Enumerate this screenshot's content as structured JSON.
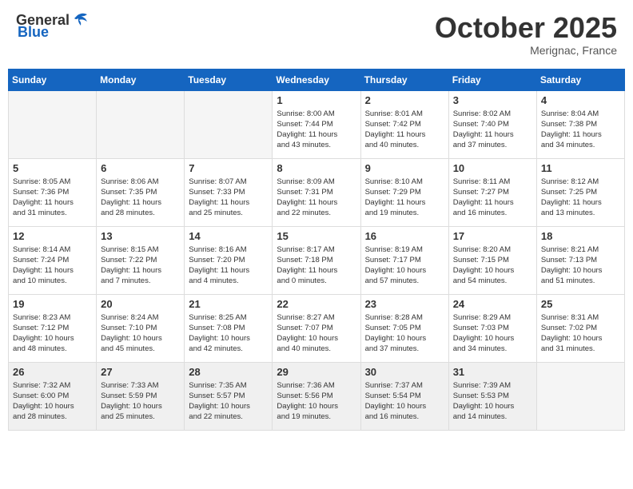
{
  "header": {
    "logo_general": "General",
    "logo_blue": "Blue",
    "month_year": "October 2025",
    "location": "Merignac, France"
  },
  "weekdays": [
    "Sunday",
    "Monday",
    "Tuesday",
    "Wednesday",
    "Thursday",
    "Friday",
    "Saturday"
  ],
  "weeks": [
    [
      {
        "day": "",
        "info": ""
      },
      {
        "day": "",
        "info": ""
      },
      {
        "day": "",
        "info": ""
      },
      {
        "day": "1",
        "info": "Sunrise: 8:00 AM\nSunset: 7:44 PM\nDaylight: 11 hours\nand 43 minutes."
      },
      {
        "day": "2",
        "info": "Sunrise: 8:01 AM\nSunset: 7:42 PM\nDaylight: 11 hours\nand 40 minutes."
      },
      {
        "day": "3",
        "info": "Sunrise: 8:02 AM\nSunset: 7:40 PM\nDaylight: 11 hours\nand 37 minutes."
      },
      {
        "day": "4",
        "info": "Sunrise: 8:04 AM\nSunset: 7:38 PM\nDaylight: 11 hours\nand 34 minutes."
      }
    ],
    [
      {
        "day": "5",
        "info": "Sunrise: 8:05 AM\nSunset: 7:36 PM\nDaylight: 11 hours\nand 31 minutes."
      },
      {
        "day": "6",
        "info": "Sunrise: 8:06 AM\nSunset: 7:35 PM\nDaylight: 11 hours\nand 28 minutes."
      },
      {
        "day": "7",
        "info": "Sunrise: 8:07 AM\nSunset: 7:33 PM\nDaylight: 11 hours\nand 25 minutes."
      },
      {
        "day": "8",
        "info": "Sunrise: 8:09 AM\nSunset: 7:31 PM\nDaylight: 11 hours\nand 22 minutes."
      },
      {
        "day": "9",
        "info": "Sunrise: 8:10 AM\nSunset: 7:29 PM\nDaylight: 11 hours\nand 19 minutes."
      },
      {
        "day": "10",
        "info": "Sunrise: 8:11 AM\nSunset: 7:27 PM\nDaylight: 11 hours\nand 16 minutes."
      },
      {
        "day": "11",
        "info": "Sunrise: 8:12 AM\nSunset: 7:25 PM\nDaylight: 11 hours\nand 13 minutes."
      }
    ],
    [
      {
        "day": "12",
        "info": "Sunrise: 8:14 AM\nSunset: 7:24 PM\nDaylight: 11 hours\nand 10 minutes."
      },
      {
        "day": "13",
        "info": "Sunrise: 8:15 AM\nSunset: 7:22 PM\nDaylight: 11 hours\nand 7 minutes."
      },
      {
        "day": "14",
        "info": "Sunrise: 8:16 AM\nSunset: 7:20 PM\nDaylight: 11 hours\nand 4 minutes."
      },
      {
        "day": "15",
        "info": "Sunrise: 8:17 AM\nSunset: 7:18 PM\nDaylight: 11 hours\nand 0 minutes."
      },
      {
        "day": "16",
        "info": "Sunrise: 8:19 AM\nSunset: 7:17 PM\nDaylight: 10 hours\nand 57 minutes."
      },
      {
        "day": "17",
        "info": "Sunrise: 8:20 AM\nSunset: 7:15 PM\nDaylight: 10 hours\nand 54 minutes."
      },
      {
        "day": "18",
        "info": "Sunrise: 8:21 AM\nSunset: 7:13 PM\nDaylight: 10 hours\nand 51 minutes."
      }
    ],
    [
      {
        "day": "19",
        "info": "Sunrise: 8:23 AM\nSunset: 7:12 PM\nDaylight: 10 hours\nand 48 minutes."
      },
      {
        "day": "20",
        "info": "Sunrise: 8:24 AM\nSunset: 7:10 PM\nDaylight: 10 hours\nand 45 minutes."
      },
      {
        "day": "21",
        "info": "Sunrise: 8:25 AM\nSunset: 7:08 PM\nDaylight: 10 hours\nand 42 minutes."
      },
      {
        "day": "22",
        "info": "Sunrise: 8:27 AM\nSunset: 7:07 PM\nDaylight: 10 hours\nand 40 minutes."
      },
      {
        "day": "23",
        "info": "Sunrise: 8:28 AM\nSunset: 7:05 PM\nDaylight: 10 hours\nand 37 minutes."
      },
      {
        "day": "24",
        "info": "Sunrise: 8:29 AM\nSunset: 7:03 PM\nDaylight: 10 hours\nand 34 minutes."
      },
      {
        "day": "25",
        "info": "Sunrise: 8:31 AM\nSunset: 7:02 PM\nDaylight: 10 hours\nand 31 minutes."
      }
    ],
    [
      {
        "day": "26",
        "info": "Sunrise: 7:32 AM\nSunset: 6:00 PM\nDaylight: 10 hours\nand 28 minutes."
      },
      {
        "day": "27",
        "info": "Sunrise: 7:33 AM\nSunset: 5:59 PM\nDaylight: 10 hours\nand 25 minutes."
      },
      {
        "day": "28",
        "info": "Sunrise: 7:35 AM\nSunset: 5:57 PM\nDaylight: 10 hours\nand 22 minutes."
      },
      {
        "day": "29",
        "info": "Sunrise: 7:36 AM\nSunset: 5:56 PM\nDaylight: 10 hours\nand 19 minutes."
      },
      {
        "day": "30",
        "info": "Sunrise: 7:37 AM\nSunset: 5:54 PM\nDaylight: 10 hours\nand 16 minutes."
      },
      {
        "day": "31",
        "info": "Sunrise: 7:39 AM\nSunset: 5:53 PM\nDaylight: 10 hours\nand 14 minutes."
      },
      {
        "day": "",
        "info": ""
      }
    ]
  ]
}
